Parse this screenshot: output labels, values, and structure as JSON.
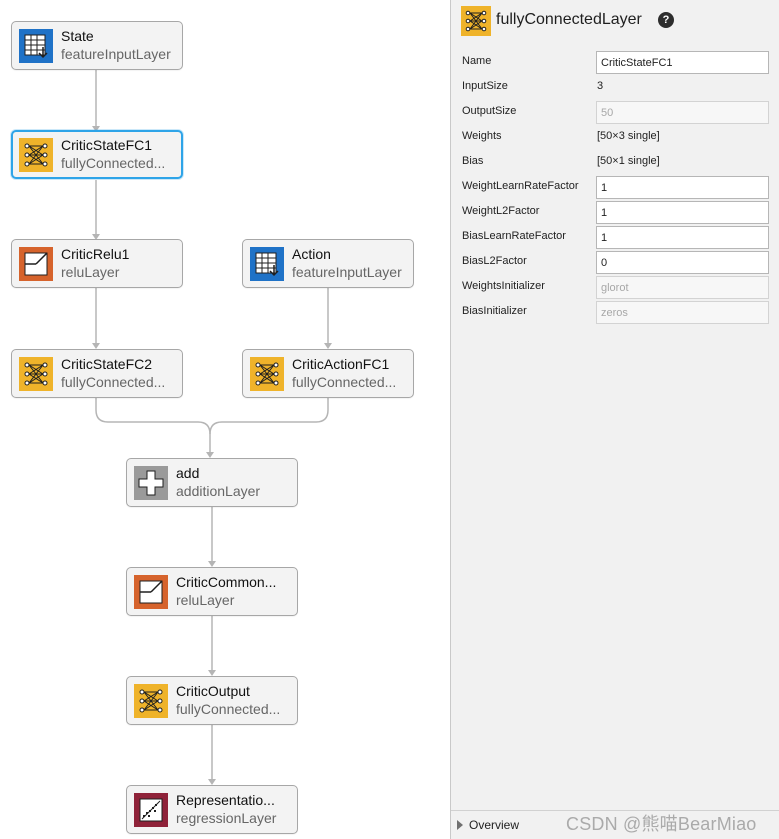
{
  "colors": {
    "connector": "#b5b5b5",
    "selected_outline": "#2ea4e8",
    "input_layer": "#1f72c7",
    "fc_layer": "#efb32a",
    "relu_layer": "#d6632c",
    "add_layer": "#9a9a9a",
    "regression_layer": "#8f2239"
  },
  "graph": {
    "nodes": [
      {
        "id": "state",
        "title": "State",
        "subtitle": "featureInputLayer",
        "icon": "feature-input-icon"
      },
      {
        "id": "critic-state-fc1",
        "title": "CriticStateFC1",
        "subtitle": "fullyConnected...",
        "icon": "fully-connected-icon",
        "selected": true
      },
      {
        "id": "critic-relu1",
        "title": "CriticRelu1",
        "subtitle": "reluLayer",
        "icon": "relu-icon"
      },
      {
        "id": "action",
        "title": "Action",
        "subtitle": "featureInputLayer",
        "icon": "feature-input-icon"
      },
      {
        "id": "critic-state-fc2",
        "title": "CriticStateFC2",
        "subtitle": "fullyConnected...",
        "icon": "fully-connected-icon"
      },
      {
        "id": "critic-action-fc1",
        "title": "CriticActionFC1",
        "subtitle": "fullyConnected...",
        "icon": "fully-connected-icon"
      },
      {
        "id": "add",
        "title": "add",
        "subtitle": "additionLayer",
        "icon": "addition-icon"
      },
      {
        "id": "critic-common",
        "title": "CriticCommon...",
        "subtitle": "reluLayer",
        "icon": "relu-icon"
      },
      {
        "id": "critic-output",
        "title": "CriticOutput",
        "subtitle": "fullyConnected...",
        "icon": "fully-connected-icon"
      },
      {
        "id": "representation",
        "title": "Representatio...",
        "subtitle": "regressionLayer",
        "icon": "regression-icon"
      }
    ]
  },
  "panel": {
    "title": "fullyConnectedLayer",
    "header_icon": "fully-connected-icon",
    "help_symbol": "?",
    "properties": {
      "name": {
        "label": "Name",
        "value": "CriticStateFC1"
      },
      "input_size": {
        "label": "InputSize",
        "value": "3"
      },
      "output_size": {
        "label": "OutputSize",
        "value": "50"
      },
      "weights": {
        "label": "Weights",
        "value": "[50×3 single]"
      },
      "bias": {
        "label": "Bias",
        "value": "[50×1 single]"
      },
      "weight_learn_rate_factor": {
        "label": "WeightLearnRateFactor",
        "value": "1"
      },
      "weight_l2_factor": {
        "label": "WeightL2Factor",
        "value": "1"
      },
      "bias_learn_rate_factor": {
        "label": "BiasLearnRateFactor",
        "value": "1"
      },
      "bias_l2_factor": {
        "label": "BiasL2Factor",
        "value": "0"
      },
      "weights_initializer": {
        "label": "WeightsInitializer",
        "value": "glorot"
      },
      "bias_initializer": {
        "label": "BiasInitializer",
        "value": "zeros"
      }
    },
    "footer": {
      "overview_label": "Overview"
    }
  },
  "watermark": "CSDN @熊喵BearMiao"
}
